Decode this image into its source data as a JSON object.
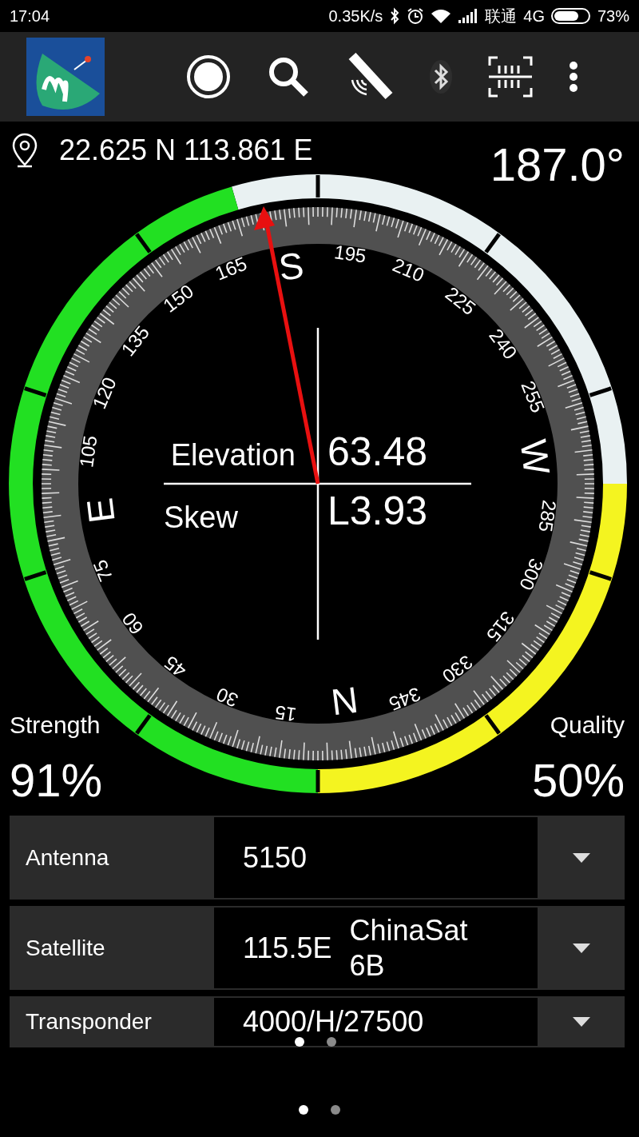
{
  "status_bar": {
    "time": "17:04",
    "net_speed": "0.35K/s",
    "carrier": "联通",
    "network": "4G",
    "battery": "73%"
  },
  "location": {
    "coordinates": "22.625 N 113.861 E"
  },
  "heading": "187.0°",
  "compass": {
    "labels": [
      "N",
      "15",
      "30",
      "45",
      "60",
      "75",
      "E",
      "105",
      "120",
      "135",
      "150",
      "165",
      "S",
      "195",
      "210",
      "225",
      "240",
      "255",
      "W",
      "285",
      "300",
      "315",
      "330",
      "345"
    ],
    "elevation": {
      "label": "Elevation",
      "value": "63.48"
    },
    "skew": {
      "label": "Skew",
      "value": "L3.93"
    }
  },
  "strength": {
    "label": "Strength",
    "reading": "91%"
  },
  "quality": {
    "label": "Quality",
    "reading": "50%"
  },
  "settings": [
    {
      "label": "Antenna",
      "value": "5150"
    },
    {
      "label": "Satellite",
      "value": "115.5E",
      "name": "ChinaSat 6B"
    },
    {
      "label": "Transponder",
      "value": "4000/H/27500"
    }
  ],
  "pagers": [
    {
      "dots": [
        {
          "selected": true
        },
        {
          "selected": false
        }
      ]
    },
    {
      "dots": [
        {
          "selected": true
        },
        {
          "selected": false
        }
      ]
    }
  ]
}
